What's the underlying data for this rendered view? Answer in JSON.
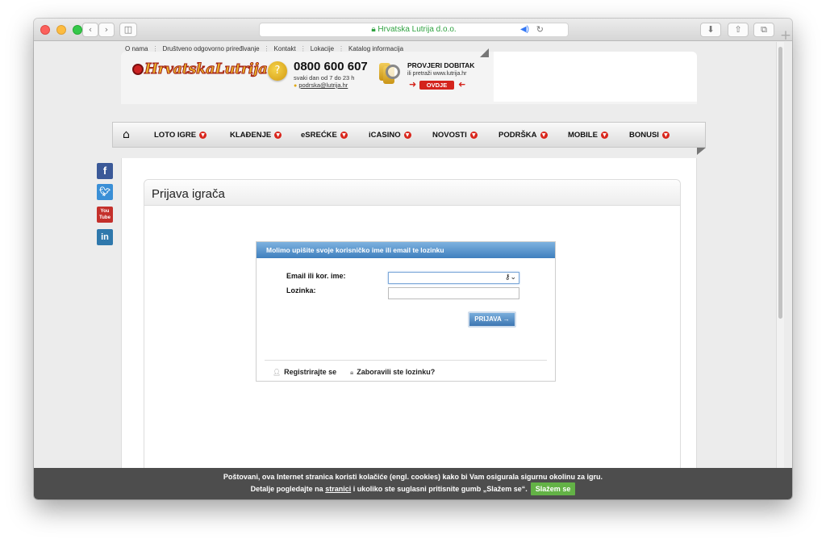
{
  "browser": {
    "url_text": "Hrvatska Lutrija d.o.o.",
    "lock_icon": "lock-icon",
    "speaker_icon": "speaker-icon",
    "reload_icon": "reload-icon",
    "back_icon": "back-icon",
    "forward_icon": "forward-icon",
    "sidebar_icon": "sidebar-icon",
    "download_icon": "download-icon",
    "share_icon": "share-icon",
    "tabs_icon": "tabs-icon",
    "new_tab_icon": "plus-icon"
  },
  "top_links": [
    "O nama",
    "Društveno odgovorno priređivanje",
    "Kontakt",
    "Lokacije",
    "Katalog informacija"
  ],
  "header": {
    "logo_text": "HrvatskaLutrija",
    "phone": "0800 600 607",
    "phone_hours": "svaki dan od 7 do 23 h",
    "support_email": "podrska@lutrija.hr",
    "check_title": "PROVJERI DOBITAK",
    "check_sub": "ili pretraži www.lutrija.hr",
    "check_button": "OVDJE"
  },
  "nav": {
    "home_icon": "home-icon",
    "items": [
      "LOTO IGRE",
      "KLAĐENJE",
      "eSREĆKE",
      "iCASINO",
      "NOVOSTI",
      "PODRŠKA",
      "MOBILE",
      "BONUSI"
    ]
  },
  "social": [
    {
      "name": "facebook-icon",
      "glyph": "f",
      "color": "#3b5998"
    },
    {
      "name": "twitter-icon",
      "glyph": "🐦",
      "color": "#3a8fd6"
    },
    {
      "name": "youtube-icon",
      "glyph": "You Tube",
      "color": "#c4302b"
    },
    {
      "name": "linkedin-icon",
      "glyph": "in",
      "color": "#2f78ac"
    }
  ],
  "panel": {
    "title": "Prijava igrača"
  },
  "login": {
    "header": "Molimo upišite svoje korisničko ime ili email te lozinku",
    "email_label": "Email ili kor. ime:",
    "email_value": "",
    "password_label": "Lozinka:",
    "password_value": "",
    "submit_label": "PRIJAVA",
    "register_link": "Registrirajte se",
    "forgot_link": "Zaboravili ste lozinku?"
  },
  "cookie": {
    "line1": "Poštovani, ova Internet stranica koristi kolačiće (engl. cookies) kako bi Vam osigurala sigurnu okolinu za igru.",
    "line2_a": "Detalje pogledajte na",
    "line2_link": "stranici",
    "line2_b": "i ukoliko ste suglasni pritisnite gumb „Slažem se“.",
    "accept": "Slažem se"
  },
  "colors": {
    "accent": "#3f7fbe",
    "nav_dot": "#d9261c",
    "accept": "#63b246",
    "cookie_bg": "#4d4d4d"
  }
}
